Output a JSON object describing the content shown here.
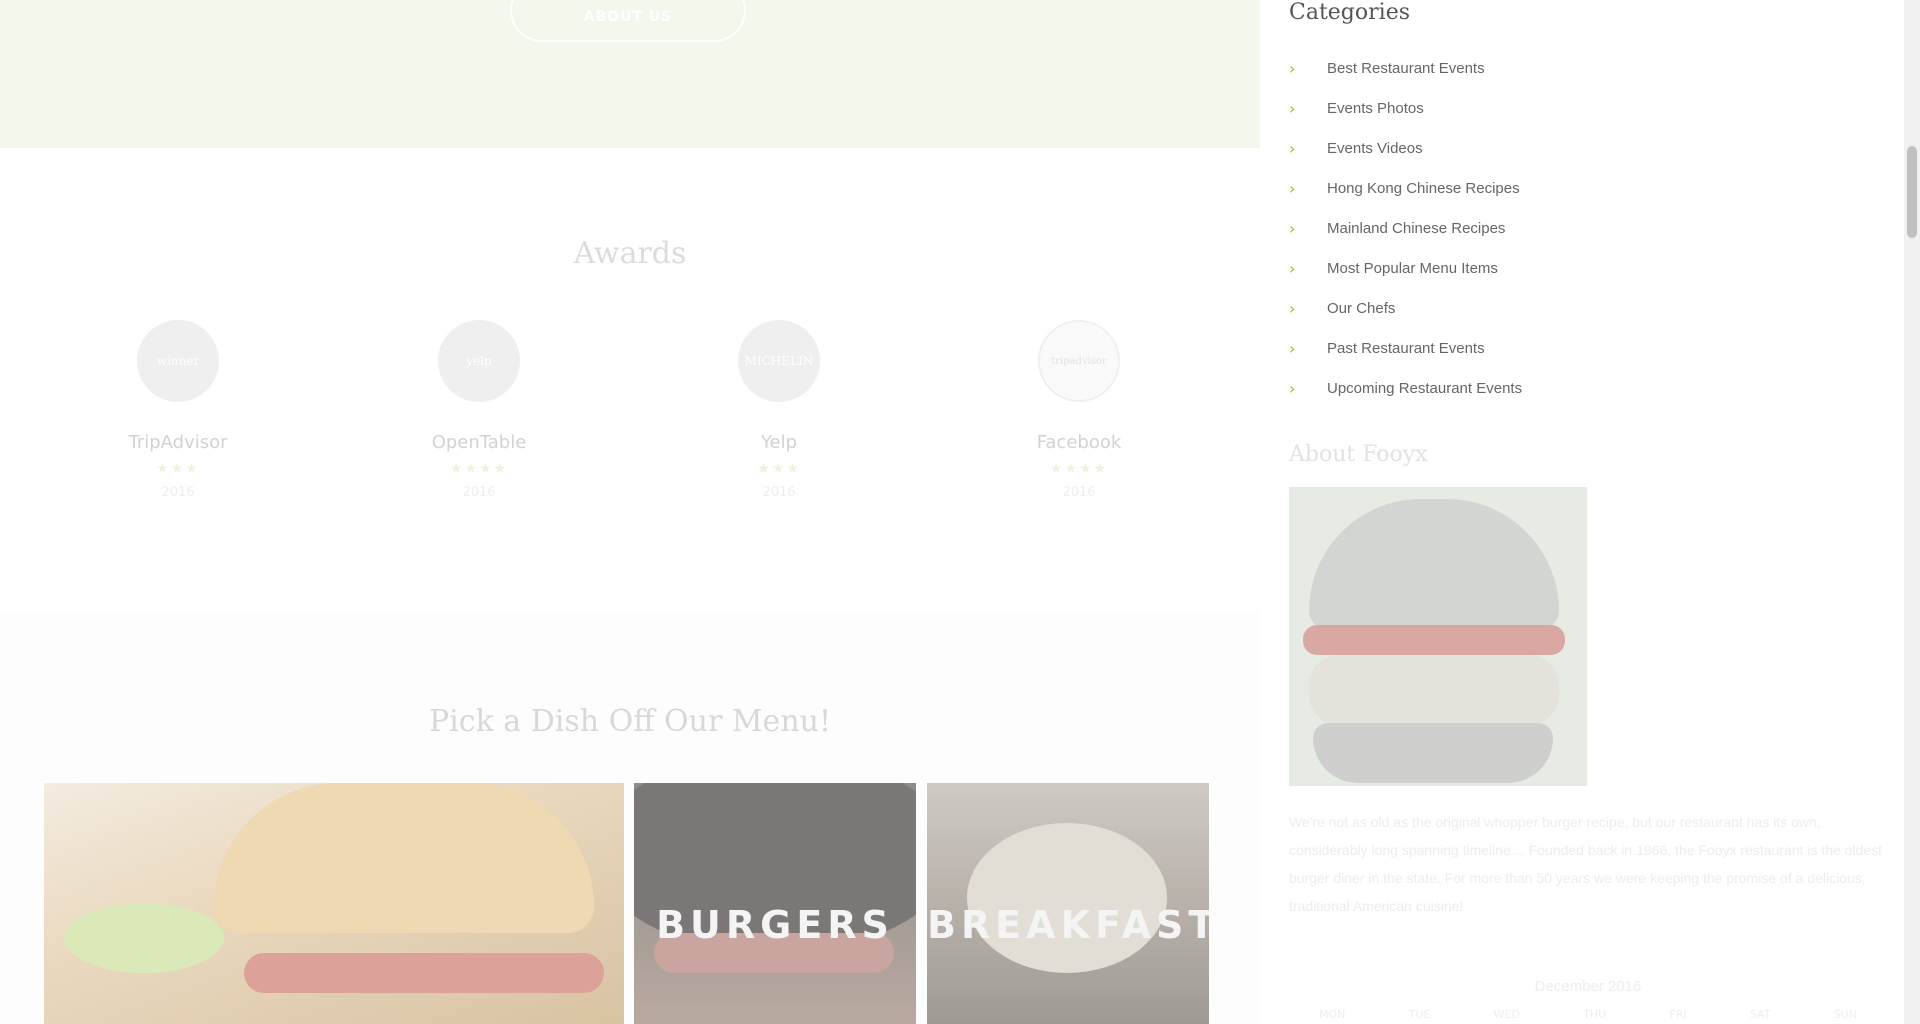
{
  "hero": {
    "about_button": "ABOUT US"
  },
  "awards": {
    "title": "Awards",
    "items": [
      {
        "badge": "winner",
        "name": "TripAdvisor",
        "stars": "★★★",
        "year": "2016"
      },
      {
        "badge": "yelp",
        "name": "OpenTable",
        "stars": "★★★★",
        "year": "2016"
      },
      {
        "badge": "MICHELIN",
        "name": "Yelp",
        "stars": "★★★",
        "year": "2016"
      },
      {
        "badge": "tripadvisor",
        "name": "Facebook",
        "stars": "★★★★",
        "year": "2016"
      }
    ]
  },
  "menu": {
    "title": "Pick a Dish Off Our Menu!",
    "tiles": [
      "",
      "BURGERS",
      "BREAKFAST"
    ]
  },
  "sidebar": {
    "categories_title": "Categories",
    "categories": [
      "Best Restaurant Events",
      "Events Photos",
      "Events Videos",
      "Hong Kong Chinese Recipes",
      "Mainland Chinese Recipes",
      "Most Popular Menu Items",
      "Our Chefs",
      "Past Restaurant Events",
      "Upcoming Restaurant Events"
    ],
    "about_title": "About Fooyx",
    "about_text": "We're not as old as the original whopper burger recipe, but our restaurant has its own, considerably long spanning timeline… Founded back in 1966, the Fooyx restaurant is the oldest burger diner in the state. For more than 50 years we were keeping the promise of a delicious, traditional American cuisine!",
    "calendar_title": "December 2016",
    "calendar_days": [
      "MON",
      "TUE",
      "WED",
      "THU",
      "FRI",
      "SAT",
      "SUN"
    ]
  },
  "colors": {
    "accent": "#9aba3b",
    "hero_bg": "#f4f7ec"
  }
}
